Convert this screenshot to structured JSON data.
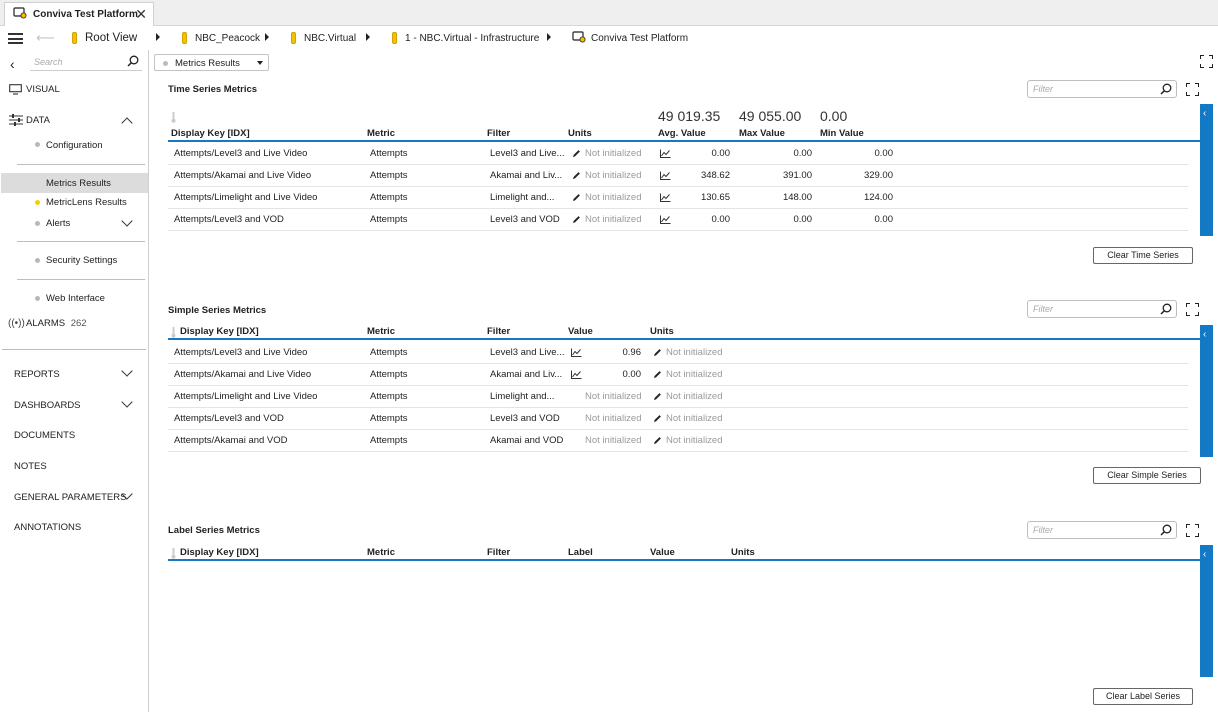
{
  "tab": {
    "title": "Conviva Test Platform",
    "close": "✕"
  },
  "breadcrumb": [
    {
      "label": "Root View",
      "icon": "folder-icon"
    },
    {
      "label": "NBC_Peacock",
      "icon": "folder-icon"
    },
    {
      "label": "NBC.Virtual",
      "icon": "folder-icon"
    },
    {
      "label": "1 - NBC.Virtual - Infrastructure",
      "icon": "folder-icon"
    },
    {
      "label": "Conviva Test Platform",
      "icon": "device-icon"
    }
  ],
  "sidebar": {
    "search_placeholder": "Search",
    "visual": "VISUAL",
    "data": "DATA",
    "items": [
      {
        "label": "Configuration"
      },
      {
        "label": "Metrics Results",
        "selected": true
      },
      {
        "label": "MetricLens Results"
      },
      {
        "label": "Alerts"
      },
      {
        "label": "Security Settings"
      },
      {
        "label": "Web Interface"
      }
    ],
    "alarms": {
      "label": "ALARMS",
      "count": "262"
    },
    "sections": [
      "REPORTS",
      "DASHBOARDS",
      "DOCUMENTS",
      "NOTES",
      "GENERAL PARAMETERS",
      "ANNOTATIONS"
    ]
  },
  "view_selector": {
    "value": "Metrics Results"
  },
  "filter_placeholder": "Filter",
  "time_series": {
    "title": "Time Series Metrics",
    "summary": {
      "avg": "49 019.35",
      "max": "49 055.00",
      "min": "0.00"
    },
    "columns": [
      "Display Key [IDX]",
      "Metric",
      "Filter",
      "Units",
      "Avg. Value",
      "Max Value",
      "Min Value"
    ],
    "rows": [
      {
        "key": "Attempts/Level3 and Live Video",
        "metric": "Attempts",
        "filter": "Level3 and Live...",
        "units": "Not initialized",
        "avg": "0.00",
        "max": "0.00",
        "min": "0.00"
      },
      {
        "key": "Attempts/Akamai and Live Video",
        "metric": "Attempts",
        "filter": "Akamai and Liv...",
        "units": "Not initialized",
        "avg": "348.62",
        "max": "391.00",
        "min": "329.00"
      },
      {
        "key": "Attempts/Limelight and Live Video",
        "metric": "Attempts",
        "filter": "Limelight and...",
        "units": "Not initialized",
        "avg": "130.65",
        "max": "148.00",
        "min": "124.00"
      },
      {
        "key": "Attempts/Level3 and VOD",
        "metric": "Attempts",
        "filter": "Level3 and VOD",
        "units": "Not initialized",
        "avg": "0.00",
        "max": "0.00",
        "min": "0.00"
      }
    ],
    "clear_label": "Clear Time Series"
  },
  "simple_series": {
    "title": "Simple Series Metrics",
    "columns": [
      "Display Key [IDX]",
      "Metric",
      "Filter",
      "Value",
      "Units"
    ],
    "rows": [
      {
        "key": "Attempts/Level3 and Live Video",
        "metric": "Attempts",
        "filter": "Level3 and Live...",
        "value": "0.96",
        "units": "Not initialized",
        "chart": true
      },
      {
        "key": "Attempts/Akamai and Live Video",
        "metric": "Attempts",
        "filter": "Akamai and Liv...",
        "value": "0.00",
        "units": "Not initialized",
        "chart": true
      },
      {
        "key": "Attempts/Limelight and Live Video",
        "metric": "Attempts",
        "filter": "Limelight and...",
        "value": "Not initialized",
        "units": "Not initialized",
        "chart": false
      },
      {
        "key": "Attempts/Level3 and VOD",
        "metric": "Attempts",
        "filter": "Level3 and VOD",
        "value": "Not initialized",
        "units": "Not initialized",
        "chart": false
      },
      {
        "key": "Attempts/Akamai and VOD",
        "metric": "Attempts",
        "filter": "Akamai and VOD",
        "value": "Not initialized",
        "units": "Not initialized",
        "chart": false
      }
    ],
    "clear_label": "Clear Simple Series"
  },
  "label_series": {
    "title": "Label Series Metrics",
    "columns": [
      "Display Key [IDX]",
      "Metric",
      "Filter",
      "Label",
      "Value",
      "Units"
    ],
    "clear_label": "Clear Label Series"
  },
  "colors": {
    "accent": "#1479c4",
    "folder": "#f2c200",
    "selected": "#dcdcdc"
  }
}
